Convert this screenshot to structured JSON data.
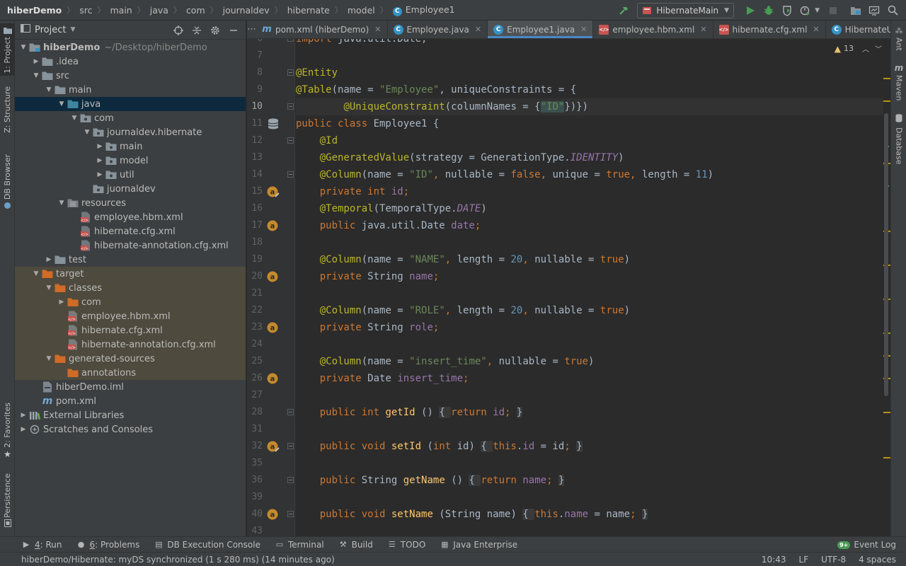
{
  "breadcrumbs": [
    "hiberDemo",
    "src",
    "main",
    "java",
    "com",
    "journaldev",
    "hibernate",
    "model",
    "Employee1"
  ],
  "run_config": {
    "label": "HibernateMain"
  },
  "colors": {
    "accent": "#4a88c7",
    "selection": "#0d293e",
    "excluded": "#4e4a3d",
    "folder": "#87939a",
    "source_folder": "#3e86a0",
    "resources_folder": "#7a7e85",
    "excluded_folder": "#d06b28"
  },
  "project_panel": {
    "title": "Project"
  },
  "tree": [
    {
      "label": "hiberDemo",
      "suffix": "~/Desktop/hiberDemo",
      "depth": 0,
      "expanded": true,
      "icon": "folder-module-icon",
      "bold": true
    },
    {
      "label": ".idea",
      "depth": 1,
      "expanded": false,
      "icon": "folder-icon"
    },
    {
      "label": "src",
      "depth": 1,
      "expanded": true,
      "icon": "folder-icon"
    },
    {
      "label": "main",
      "depth": 2,
      "expanded": true,
      "icon": "folder-icon"
    },
    {
      "label": "java",
      "depth": 3,
      "expanded": true,
      "icon": "source-folder-icon",
      "selected": true
    },
    {
      "label": "com",
      "depth": 4,
      "expanded": true,
      "icon": "package-icon"
    },
    {
      "label": "journaldev.hibernate",
      "depth": 5,
      "expanded": true,
      "icon": "package-icon"
    },
    {
      "label": "main",
      "depth": 6,
      "expanded": false,
      "icon": "package-icon"
    },
    {
      "label": "model",
      "depth": 6,
      "expanded": false,
      "icon": "package-icon"
    },
    {
      "label": "util",
      "depth": 6,
      "expanded": false,
      "icon": "package-icon"
    },
    {
      "label": "juornaldev",
      "depth": 5,
      "icon": "package-icon"
    },
    {
      "label": "resources",
      "depth": 3,
      "expanded": true,
      "icon": "resources-folder-icon"
    },
    {
      "label": "employee.hbm.xml",
      "depth": 4,
      "icon": "xml-file-icon"
    },
    {
      "label": "hibernate.cfg.xml",
      "depth": 4,
      "icon": "xml-file-icon"
    },
    {
      "label": "hibernate-annotation.cfg.xml",
      "depth": 4,
      "icon": "xml-file-icon"
    },
    {
      "label": "test",
      "depth": 2,
      "expanded": false,
      "icon": "folder-icon"
    },
    {
      "label": "target",
      "depth": 1,
      "expanded": true,
      "icon": "excluded-folder-icon",
      "excluded": true
    },
    {
      "label": "classes",
      "depth": 2,
      "expanded": true,
      "icon": "excluded-folder-icon",
      "excluded": true
    },
    {
      "label": "com",
      "depth": 3,
      "expanded": false,
      "icon": "excluded-folder-icon",
      "excluded": true
    },
    {
      "label": "employee.hbm.xml",
      "depth": 3,
      "icon": "xml-file-icon",
      "excluded": true
    },
    {
      "label": "hibernate.cfg.xml",
      "depth": 3,
      "icon": "xml-file-icon",
      "excluded": true
    },
    {
      "label": "hibernate-annotation.cfg.xml",
      "depth": 3,
      "icon": "xml-file-icon",
      "excluded": true
    },
    {
      "label": "generated-sources",
      "depth": 2,
      "expanded": true,
      "icon": "excluded-folder-icon",
      "excluded": true
    },
    {
      "label": "annotations",
      "depth": 3,
      "icon": "excluded-folder-icon",
      "excluded": true
    },
    {
      "label": "hiberDemo.iml",
      "depth": 1,
      "icon": "iml-file-icon"
    },
    {
      "label": "pom.xml",
      "depth": 1,
      "icon": "maven-file-icon"
    },
    {
      "label": "External Libraries",
      "depth": 0,
      "expanded": false,
      "icon": "libraries-icon"
    },
    {
      "label": "Scratches and Consoles",
      "depth": 0,
      "expanded": false,
      "icon": "scratches-icon"
    }
  ],
  "tabs": [
    {
      "label": "pom.xml (hiberDemo)",
      "icon": "maven-icon"
    },
    {
      "label": "Employee.java",
      "icon": "class-icon"
    },
    {
      "label": "Employee1.java",
      "icon": "class-icon",
      "active": true
    },
    {
      "label": "employee.hbm.xml",
      "icon": "xml-icon"
    },
    {
      "label": "hibernate.cfg.xml",
      "icon": "xml-icon"
    },
    {
      "label": "HibernateUtil.java",
      "icon": "class-icon"
    },
    {
      "label": "H",
      "icon": "class-icon"
    }
  ],
  "inspection": {
    "warnings": "13"
  },
  "editor": {
    "current_line": 10,
    "lines": [
      {
        "n": 6,
        "tokens": [
          [
            "kw",
            "import "
          ],
          [
            "",
            "java.util.Date;"
          ]
        ],
        "clip": true,
        "fold": true
      },
      {
        "n": 7,
        "tokens": []
      },
      {
        "n": 8,
        "tokens": [
          [
            "ann",
            "@Entity"
          ]
        ],
        "fold": true
      },
      {
        "n": 9,
        "tokens": [
          [
            "ann",
            "@Table"
          ],
          [
            "",
            "(name = "
          ],
          [
            "str",
            "\"Employee\""
          ],
          [
            "",
            ", uniqueConstraints = {"
          ]
        ]
      },
      {
        "n": 10,
        "tokens": [
          [
            "",
            "        "
          ],
          [
            "ann",
            "@UniqueConstraint"
          ],
          [
            "",
            "(columnNames = {"
          ],
          [
            "str",
            "\"ID\""
          ],
          [
            "",
            "})})"
          ]
        ],
        "fold": true
      },
      {
        "n": 11,
        "tokens": [
          [
            "kw",
            "public class "
          ],
          [
            "",
            "Employee1 {"
          ]
        ],
        "marker": "db"
      },
      {
        "n": 12,
        "tokens": [
          [
            "",
            "    "
          ],
          [
            "ann",
            "@Id"
          ]
        ],
        "fold": true
      },
      {
        "n": 13,
        "tokens": [
          [
            "",
            "    "
          ],
          [
            "ann",
            "@GeneratedValue"
          ],
          [
            "",
            "(strategy = GenerationType."
          ],
          [
            "const",
            "IDENTITY"
          ],
          [
            "",
            ")"
          ]
        ]
      },
      {
        "n": 14,
        "tokens": [
          [
            "",
            "    "
          ],
          [
            "ann",
            "@Column"
          ],
          [
            "",
            "(name = "
          ],
          [
            "str",
            "\"ID\""
          ],
          [
            "kw",
            ", "
          ],
          [
            "",
            "nullable = "
          ],
          [
            "kw",
            "false, "
          ],
          [
            "",
            "unique = "
          ],
          [
            "kw",
            "true, "
          ],
          [
            "",
            "length = "
          ],
          [
            "num",
            "11"
          ],
          [
            "",
            ")"
          ]
        ],
        "fold": true
      },
      {
        "n": 15,
        "tokens": [
          [
            "",
            "    "
          ],
          [
            "kw",
            "private int "
          ],
          [
            "fld",
            "id"
          ],
          [
            "kw",
            ";"
          ]
        ],
        "marker": "at-edit"
      },
      {
        "n": 16,
        "tokens": [
          [
            "",
            "    "
          ],
          [
            "ann",
            "@Temporal"
          ],
          [
            "",
            "(TemporalType."
          ],
          [
            "const",
            "DATE"
          ],
          [
            "",
            ")"
          ]
        ]
      },
      {
        "n": 17,
        "tokens": [
          [
            "",
            "    "
          ],
          [
            "kw",
            "public "
          ],
          [
            "",
            "java.util.Date "
          ],
          [
            "fld",
            "date"
          ],
          [
            "kw",
            ";"
          ]
        ],
        "marker": "at"
      },
      {
        "n": 18,
        "tokens": []
      },
      {
        "n": 19,
        "tokens": [
          [
            "",
            "    "
          ],
          [
            "ann",
            "@Column"
          ],
          [
            "",
            "(name = "
          ],
          [
            "str",
            "\"NAME\""
          ],
          [
            "kw",
            ", "
          ],
          [
            "",
            "length = "
          ],
          [
            "num",
            "20"
          ],
          [
            "kw",
            ", "
          ],
          [
            "",
            "nullable = "
          ],
          [
            "kw",
            "true"
          ],
          [
            "",
            ")"
          ]
        ]
      },
      {
        "n": 20,
        "tokens": [
          [
            "",
            "    "
          ],
          [
            "kw",
            "private "
          ],
          [
            "",
            "String "
          ],
          [
            "fld",
            "name"
          ],
          [
            "kw",
            ";"
          ]
        ],
        "marker": "at"
      },
      {
        "n": 21,
        "tokens": []
      },
      {
        "n": 22,
        "tokens": [
          [
            "",
            "    "
          ],
          [
            "ann",
            "@Column"
          ],
          [
            "",
            "(name = "
          ],
          [
            "str",
            "\"ROLE\""
          ],
          [
            "kw",
            ", "
          ],
          [
            "",
            "length = "
          ],
          [
            "num",
            "20"
          ],
          [
            "kw",
            ", "
          ],
          [
            "",
            "nullable = "
          ],
          [
            "kw",
            "true"
          ],
          [
            "",
            ")"
          ]
        ]
      },
      {
        "n": 23,
        "tokens": [
          [
            "",
            "    "
          ],
          [
            "kw",
            "private "
          ],
          [
            "",
            "String "
          ],
          [
            "fld",
            "role"
          ],
          [
            "kw",
            ";"
          ]
        ],
        "marker": "at"
      },
      {
        "n": 24,
        "tokens": []
      },
      {
        "n": 25,
        "tokens": [
          [
            "",
            "    "
          ],
          [
            "ann",
            "@Column"
          ],
          [
            "",
            "(name = "
          ],
          [
            "str",
            "\"insert_time\""
          ],
          [
            "kw",
            ", "
          ],
          [
            "",
            "nullable = "
          ],
          [
            "kw",
            "true"
          ],
          [
            "",
            ")"
          ]
        ]
      },
      {
        "n": 26,
        "tokens": [
          [
            "",
            "    "
          ],
          [
            "kw",
            "private "
          ],
          [
            "",
            "Date "
          ],
          [
            "fld",
            "insert_time"
          ],
          [
            "kw",
            ";"
          ]
        ],
        "marker": "at"
      },
      {
        "n": 27,
        "tokens": []
      },
      {
        "n": 28,
        "tokens": [
          [
            "",
            "    "
          ],
          [
            "kw",
            "public int "
          ],
          [
            "mth",
            "getId"
          ],
          [
            "",
            " () "
          ],
          [
            "fold-in",
            "{ "
          ],
          [
            "kw",
            "return "
          ],
          [
            "fld",
            "id"
          ],
          [
            "kw",
            "; "
          ],
          [
            "fold-in",
            "}"
          ]
        ],
        "fold": true
      },
      {
        "n": 31,
        "tokens": []
      },
      {
        "n": 32,
        "tokens": [
          [
            "",
            "    "
          ],
          [
            "kw",
            "public void "
          ],
          [
            "mth",
            "setId"
          ],
          [
            "",
            " ("
          ],
          [
            "kw",
            "int "
          ],
          [
            "",
            "id) "
          ],
          [
            "fold-in",
            "{ "
          ],
          [
            "kw",
            "this"
          ],
          [
            "",
            ".",
            "n"
          ],
          [
            "fld",
            "id"
          ],
          [
            "",
            " = id"
          ],
          [
            "kw",
            "; "
          ],
          [
            "fold-in",
            "}"
          ]
        ],
        "marker": "at-edit",
        "fold": true
      },
      {
        "n": 35,
        "tokens": []
      },
      {
        "n": 36,
        "tokens": [
          [
            "",
            "    "
          ],
          [
            "kw",
            "public "
          ],
          [
            "",
            "String "
          ],
          [
            "mth",
            "getName"
          ],
          [
            "",
            " () "
          ],
          [
            "fold-in",
            "{ "
          ],
          [
            "kw",
            "return "
          ],
          [
            "fld",
            "name"
          ],
          [
            "kw",
            "; "
          ],
          [
            "fold-in",
            "}"
          ]
        ],
        "fold": true
      },
      {
        "n": 39,
        "tokens": []
      },
      {
        "n": 40,
        "tokens": [
          [
            "",
            "    "
          ],
          [
            "kw",
            "public void "
          ],
          [
            "mth",
            "setName"
          ],
          [
            "",
            " (String name) "
          ],
          [
            "fold-in",
            "{ "
          ],
          [
            "kw",
            "this"
          ],
          [
            "",
            "."
          ],
          [
            "fld",
            "name"
          ],
          [
            "",
            " = name"
          ],
          [
            "kw",
            "; "
          ],
          [
            "fold-in",
            "}"
          ]
        ],
        "marker": "at",
        "fold": true
      },
      {
        "n": 43,
        "tokens": []
      }
    ]
  },
  "left_stripe": [
    {
      "label": "1: Project",
      "icon": "folder-icon",
      "active": true
    },
    {
      "label": "Z: Structure",
      "icon": "structure-icon"
    },
    {
      "label": "DB Browser",
      "icon": "db-icon"
    },
    {
      "label": "2: Favorites",
      "icon": "star-icon"
    },
    {
      "label": "Persistence",
      "icon": "persistence-icon"
    }
  ],
  "right_stripe": [
    {
      "label": "Ant",
      "icon": "ant-icon"
    },
    {
      "label": "Maven",
      "icon": "maven-icon"
    },
    {
      "label": "Database",
      "icon": "database-icon"
    }
  ],
  "bottom_tools": [
    {
      "num": "4",
      "label": ": Run",
      "icon": "run-icon"
    },
    {
      "num": "6",
      "label": ": Problems",
      "icon": "problems-icon"
    },
    {
      "num": "",
      "label": "DB Execution Console",
      "icon": "db-console-icon"
    },
    {
      "num": "",
      "label": "Terminal",
      "icon": "terminal-icon"
    },
    {
      "num": "",
      "label": "Build",
      "icon": "build-icon"
    },
    {
      "num": "",
      "label": "TODO",
      "icon": "todo-icon"
    },
    {
      "num": "",
      "label": "Java Enterprise",
      "icon": "java-enterprise-icon"
    }
  ],
  "event_log": {
    "label": "Event Log",
    "badge": "9+"
  },
  "status": {
    "message": "hiberDemo/Hibernate: myDS synchronized (1 s 280 ms) (14 minutes ago)",
    "position": "10:43",
    "line_sep": "LF",
    "encoding": "UTF-8",
    "indent": "4 spaces"
  }
}
